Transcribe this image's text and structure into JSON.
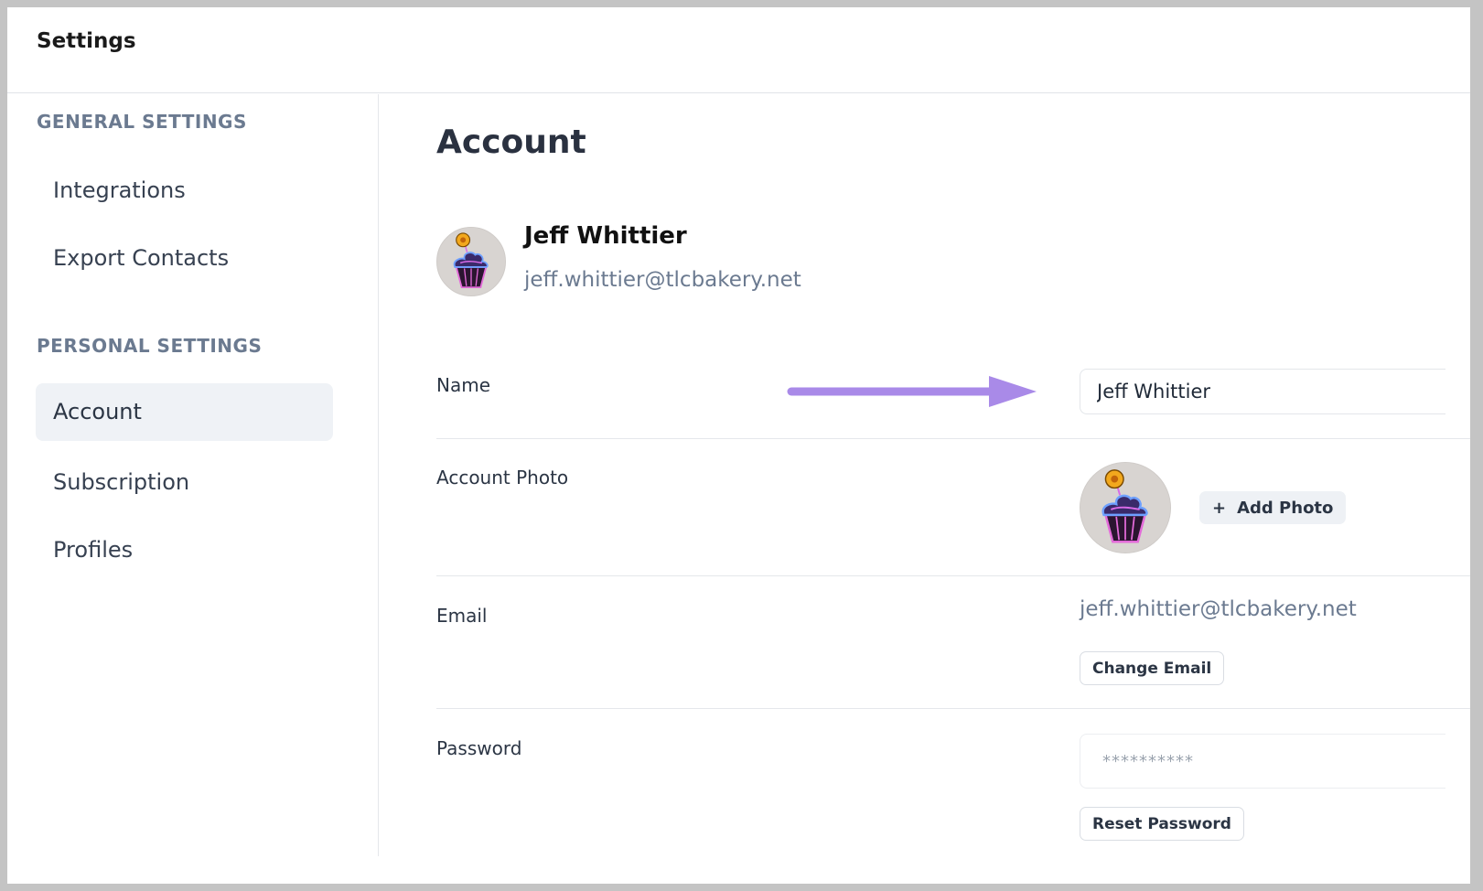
{
  "app": {
    "title": "Settings"
  },
  "sidebar": {
    "general_heading": "GENERAL SETTINGS",
    "general_items": [
      {
        "label": "Integrations"
      },
      {
        "label": "Export Contacts"
      }
    ],
    "personal_heading": "PERSONAL SETTINGS",
    "personal_items": [
      {
        "label": "Account",
        "active": true
      },
      {
        "label": "Subscription"
      },
      {
        "label": "Profiles"
      }
    ]
  },
  "main": {
    "title": "Account",
    "profile": {
      "name": "Jeff Whittier",
      "email": "jeff.whittier@tlcbakery.net",
      "avatar_icon": "cupcake-icon"
    },
    "fields": {
      "name": {
        "label": "Name",
        "value": "Jeff Whittier"
      },
      "photo": {
        "label": "Account Photo",
        "add_label": "Add Photo",
        "add_icon": "plus-icon"
      },
      "email": {
        "label": "Email",
        "value": "jeff.whittier@tlcbakery.net",
        "change_label": "Change Email"
      },
      "password": {
        "label": "Password",
        "value": "**********",
        "reset_label": "Reset Password"
      }
    }
  },
  "annotation": {
    "arrow_color": "#a98ae8"
  },
  "colors": {
    "muted_text": "#6b7a90",
    "active_nav_bg": "#eff2f6",
    "divider": "#e5e7eb"
  }
}
